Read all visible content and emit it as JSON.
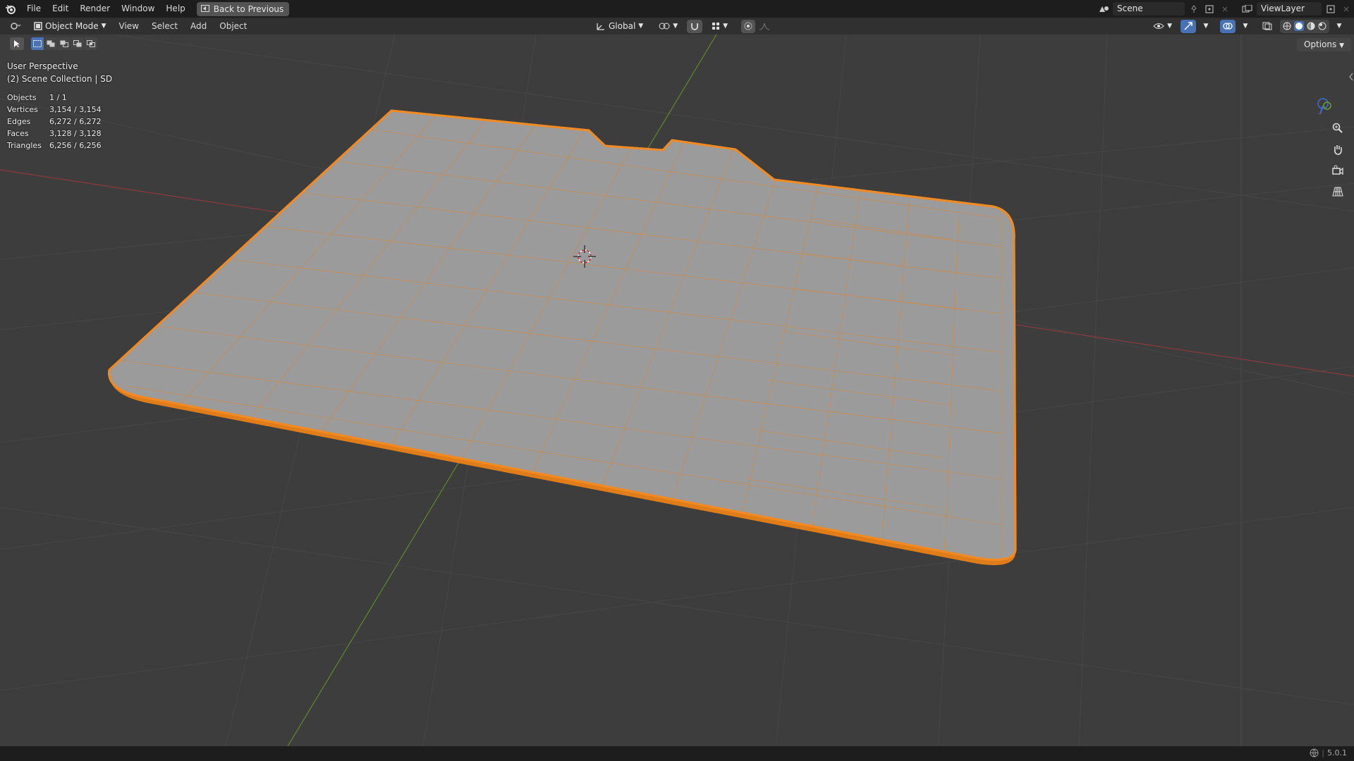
{
  "topbar": {
    "menus": [
      "File",
      "Edit",
      "Render",
      "Window",
      "Help"
    ],
    "back_button": "Back to Previous",
    "scene_name": "Scene",
    "view_layer": "ViewLayer"
  },
  "header": {
    "mode": "Object Mode",
    "menus": [
      "View",
      "Select",
      "Add",
      "Object"
    ],
    "transform_orientation": "Global"
  },
  "toolbar": {
    "options": "Options"
  },
  "viewport": {
    "perspective": "User Perspective",
    "collection": "(2) Scene Collection | SD",
    "stats": [
      {
        "label": "Objects",
        "value": "1 / 1"
      },
      {
        "label": "Vertices",
        "value": "3,154 / 3,154"
      },
      {
        "label": "Edges",
        "value": "6,272 / 6,272"
      },
      {
        "label": "Faces",
        "value": "3,128 / 3,128"
      },
      {
        "label": "Triangles",
        "value": "6,256 / 6,256"
      }
    ],
    "gizmo": {
      "x": "X",
      "y": "Y",
      "z": "Z"
    }
  },
  "status": {
    "version": "5.0.1"
  },
  "colors": {
    "selection": "#f08a24",
    "x_axis": "#c23b42",
    "y_axis": "#6b9e2a",
    "active": "#4772b3"
  }
}
